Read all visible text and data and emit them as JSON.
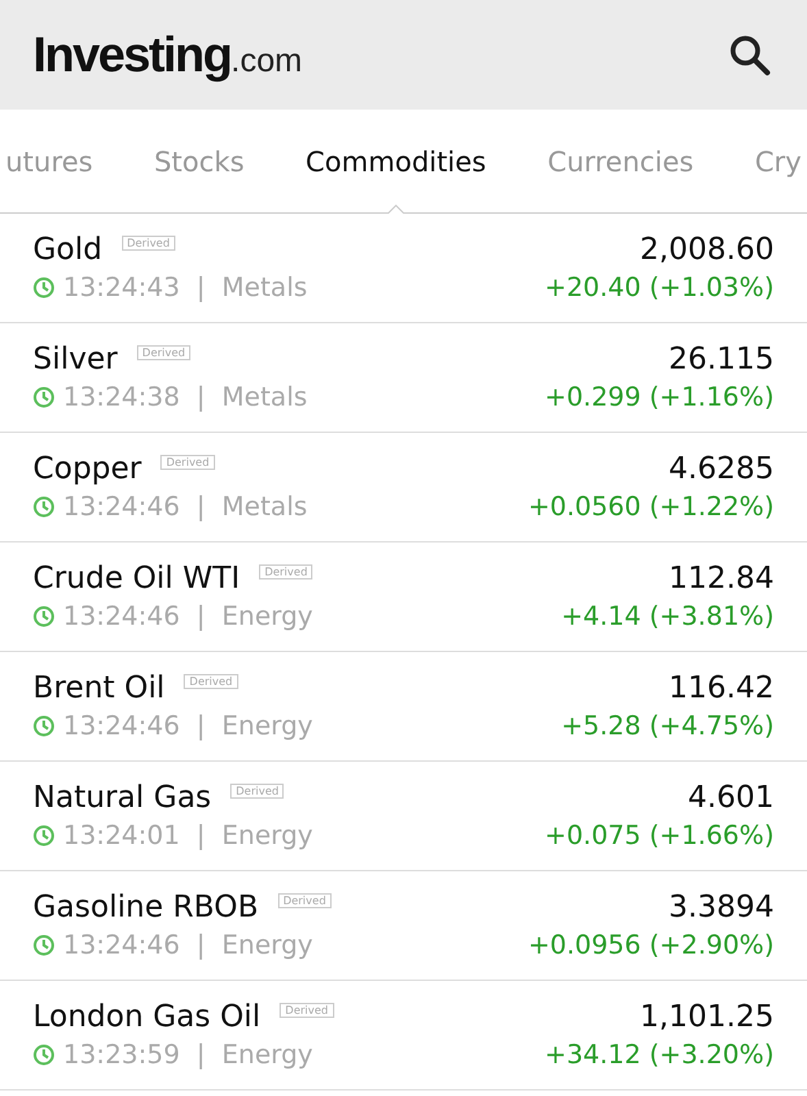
{
  "header": {
    "logo": {
      "name": "Investing",
      "suffix": ".com"
    }
  },
  "tabs": [
    {
      "label": "utures",
      "selected": false
    },
    {
      "label": "Stocks",
      "selected": false
    },
    {
      "label": "Commodities",
      "selected": true
    },
    {
      "label": "Currencies",
      "selected": false
    },
    {
      "label": "Cry",
      "selected": false
    }
  ],
  "rows": [
    {
      "name": "Gold",
      "badge": "Derived",
      "meta": "13:24:43  |  Metals",
      "price": "2,008.60",
      "change": "+20.40 (+1.03%)",
      "color": "#2a9d2a"
    },
    {
      "name": "Silver",
      "badge": "Derived",
      "meta": "13:24:38  |  Metals",
      "price": "26.115",
      "change": "+0.299 (+1.16%)",
      "color": "#2a9d2a"
    },
    {
      "name": "Copper",
      "badge": "Derived",
      "meta": "13:24:46  |  Metals",
      "price": "4.6285",
      "change": "+0.0560 (+1.22%)",
      "color": "#2a9d2a"
    },
    {
      "name": "Crude Oil WTI",
      "badge": "Derived",
      "meta": "13:24:46  |  Energy",
      "price": "112.84",
      "change": "+4.14 (+3.81%)",
      "color": "#2a9d2a"
    },
    {
      "name": "Brent Oil",
      "badge": "Derived",
      "meta": "13:24:46  |  Energy",
      "price": "116.42",
      "change": "+5.28 (+4.75%)",
      "color": "#2a9d2a"
    },
    {
      "name": "Natural Gas",
      "badge": "Derived",
      "meta": "13:24:01  |  Energy",
      "price": "4.601",
      "change": "+0.075 (+1.66%)",
      "color": "#2a9d2a"
    },
    {
      "name": "Gasoline RBOB",
      "badge": "Derived",
      "meta": "13:24:46  |  Energy",
      "price": "3.3894",
      "change": "+0.0956 (+2.90%)",
      "color": "#2a9d2a"
    },
    {
      "name": "London Gas Oil",
      "badge": "Derived",
      "meta": "13:23:59  |  Energy",
      "price": "1,101.25",
      "change": "+34.12 (+3.20%)",
      "color": "#2a9d2a"
    }
  ]
}
